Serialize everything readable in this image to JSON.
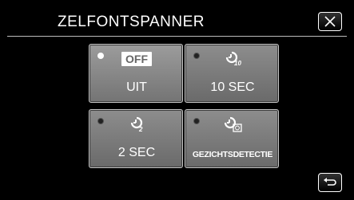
{
  "header": {
    "title": "ZELFONTSPANNER",
    "close_icon": "close-icon"
  },
  "options": [
    {
      "id": "uit",
      "label": "UIT",
      "badge": "OFF",
      "icon": "off-icon",
      "selected": true
    },
    {
      "id": "10sec",
      "label": "10 SEC",
      "icon": "self-timer-10-icon",
      "selected": false
    },
    {
      "id": "2sec",
      "label": "2 SEC",
      "icon": "self-timer-2-icon",
      "selected": false
    },
    {
      "id": "face",
      "label": "GEZICHTSDETECTIE",
      "icon": "face-detection-timer-icon",
      "selected": false
    }
  ],
  "footer": {
    "back_icon": "return-icon"
  },
  "colors": {
    "background": "#000000",
    "tile": "#7a7a7a",
    "selected_dot": "#ffffff"
  }
}
